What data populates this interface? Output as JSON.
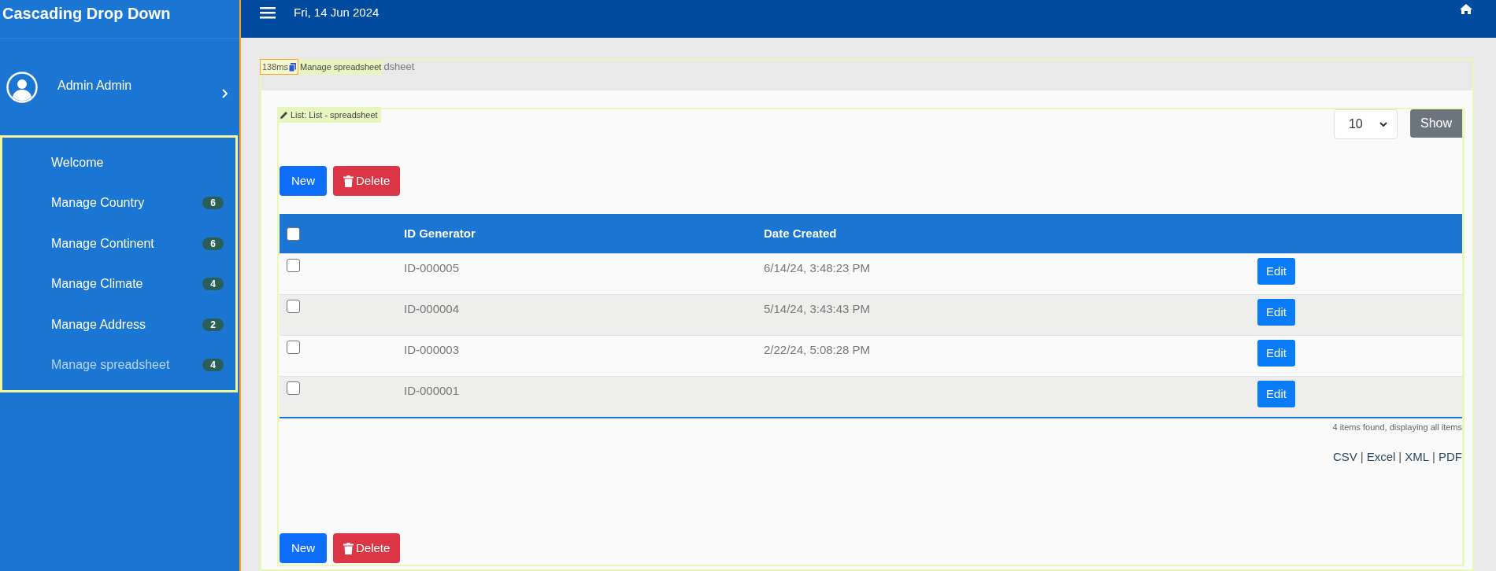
{
  "app_title": "Cascading Drop Down",
  "topbar": {
    "date": "Fri, 14 Jun 2024"
  },
  "user": {
    "name": "Admin Admin"
  },
  "nav": [
    {
      "label": "Welcome",
      "selected": false
    },
    {
      "label": "Manage Country",
      "badge": "6",
      "selected": false
    },
    {
      "label": "Manage Continent",
      "badge": "6",
      "selected": false
    },
    {
      "label": "Manage Climate",
      "badge": "4",
      "selected": false
    },
    {
      "label": "Manage Address",
      "badge": "2",
      "selected": false
    },
    {
      "label": "Manage spreadsheet",
      "badge": "4",
      "selected": true
    }
  ],
  "debug": {
    "timing": "138ms",
    "page_tag": "Manage spreadsheet",
    "breadcrumb_fragment": "dsheet",
    "list_tag": "List: List - spreadsheet"
  },
  "page_size": "10",
  "show_button": "Show",
  "top_actions": {
    "new": "New",
    "delete": "Delete"
  },
  "bottom_actions": {
    "new": "New",
    "delete": "Delete"
  },
  "table": {
    "columns": [
      "ID Generator",
      "Date Created"
    ],
    "header_checked": false,
    "rows": [
      {
        "id": "ID-000005",
        "date": "6/14/24, 3:48:23 PM",
        "checked": false,
        "action": "Edit"
      },
      {
        "id": "ID-000004",
        "date": "5/14/24, 3:43:43 PM",
        "checked": false,
        "action": "Edit"
      },
      {
        "id": "ID-000003",
        "date": "2/22/24, 5:08:28 PM",
        "checked": false,
        "action": "Edit"
      },
      {
        "id": "ID-000001",
        "date": "",
        "checked": false,
        "action": "Edit"
      }
    ]
  },
  "summary": "4 items found, displaying all items",
  "exports": [
    {
      "label": "CSV"
    },
    {
      "separator": "|",
      "label": "Excel"
    },
    {
      "separator": "|",
      "label": "XML"
    },
    {
      "separator": "|",
      "label": "PDF"
    }
  ]
}
